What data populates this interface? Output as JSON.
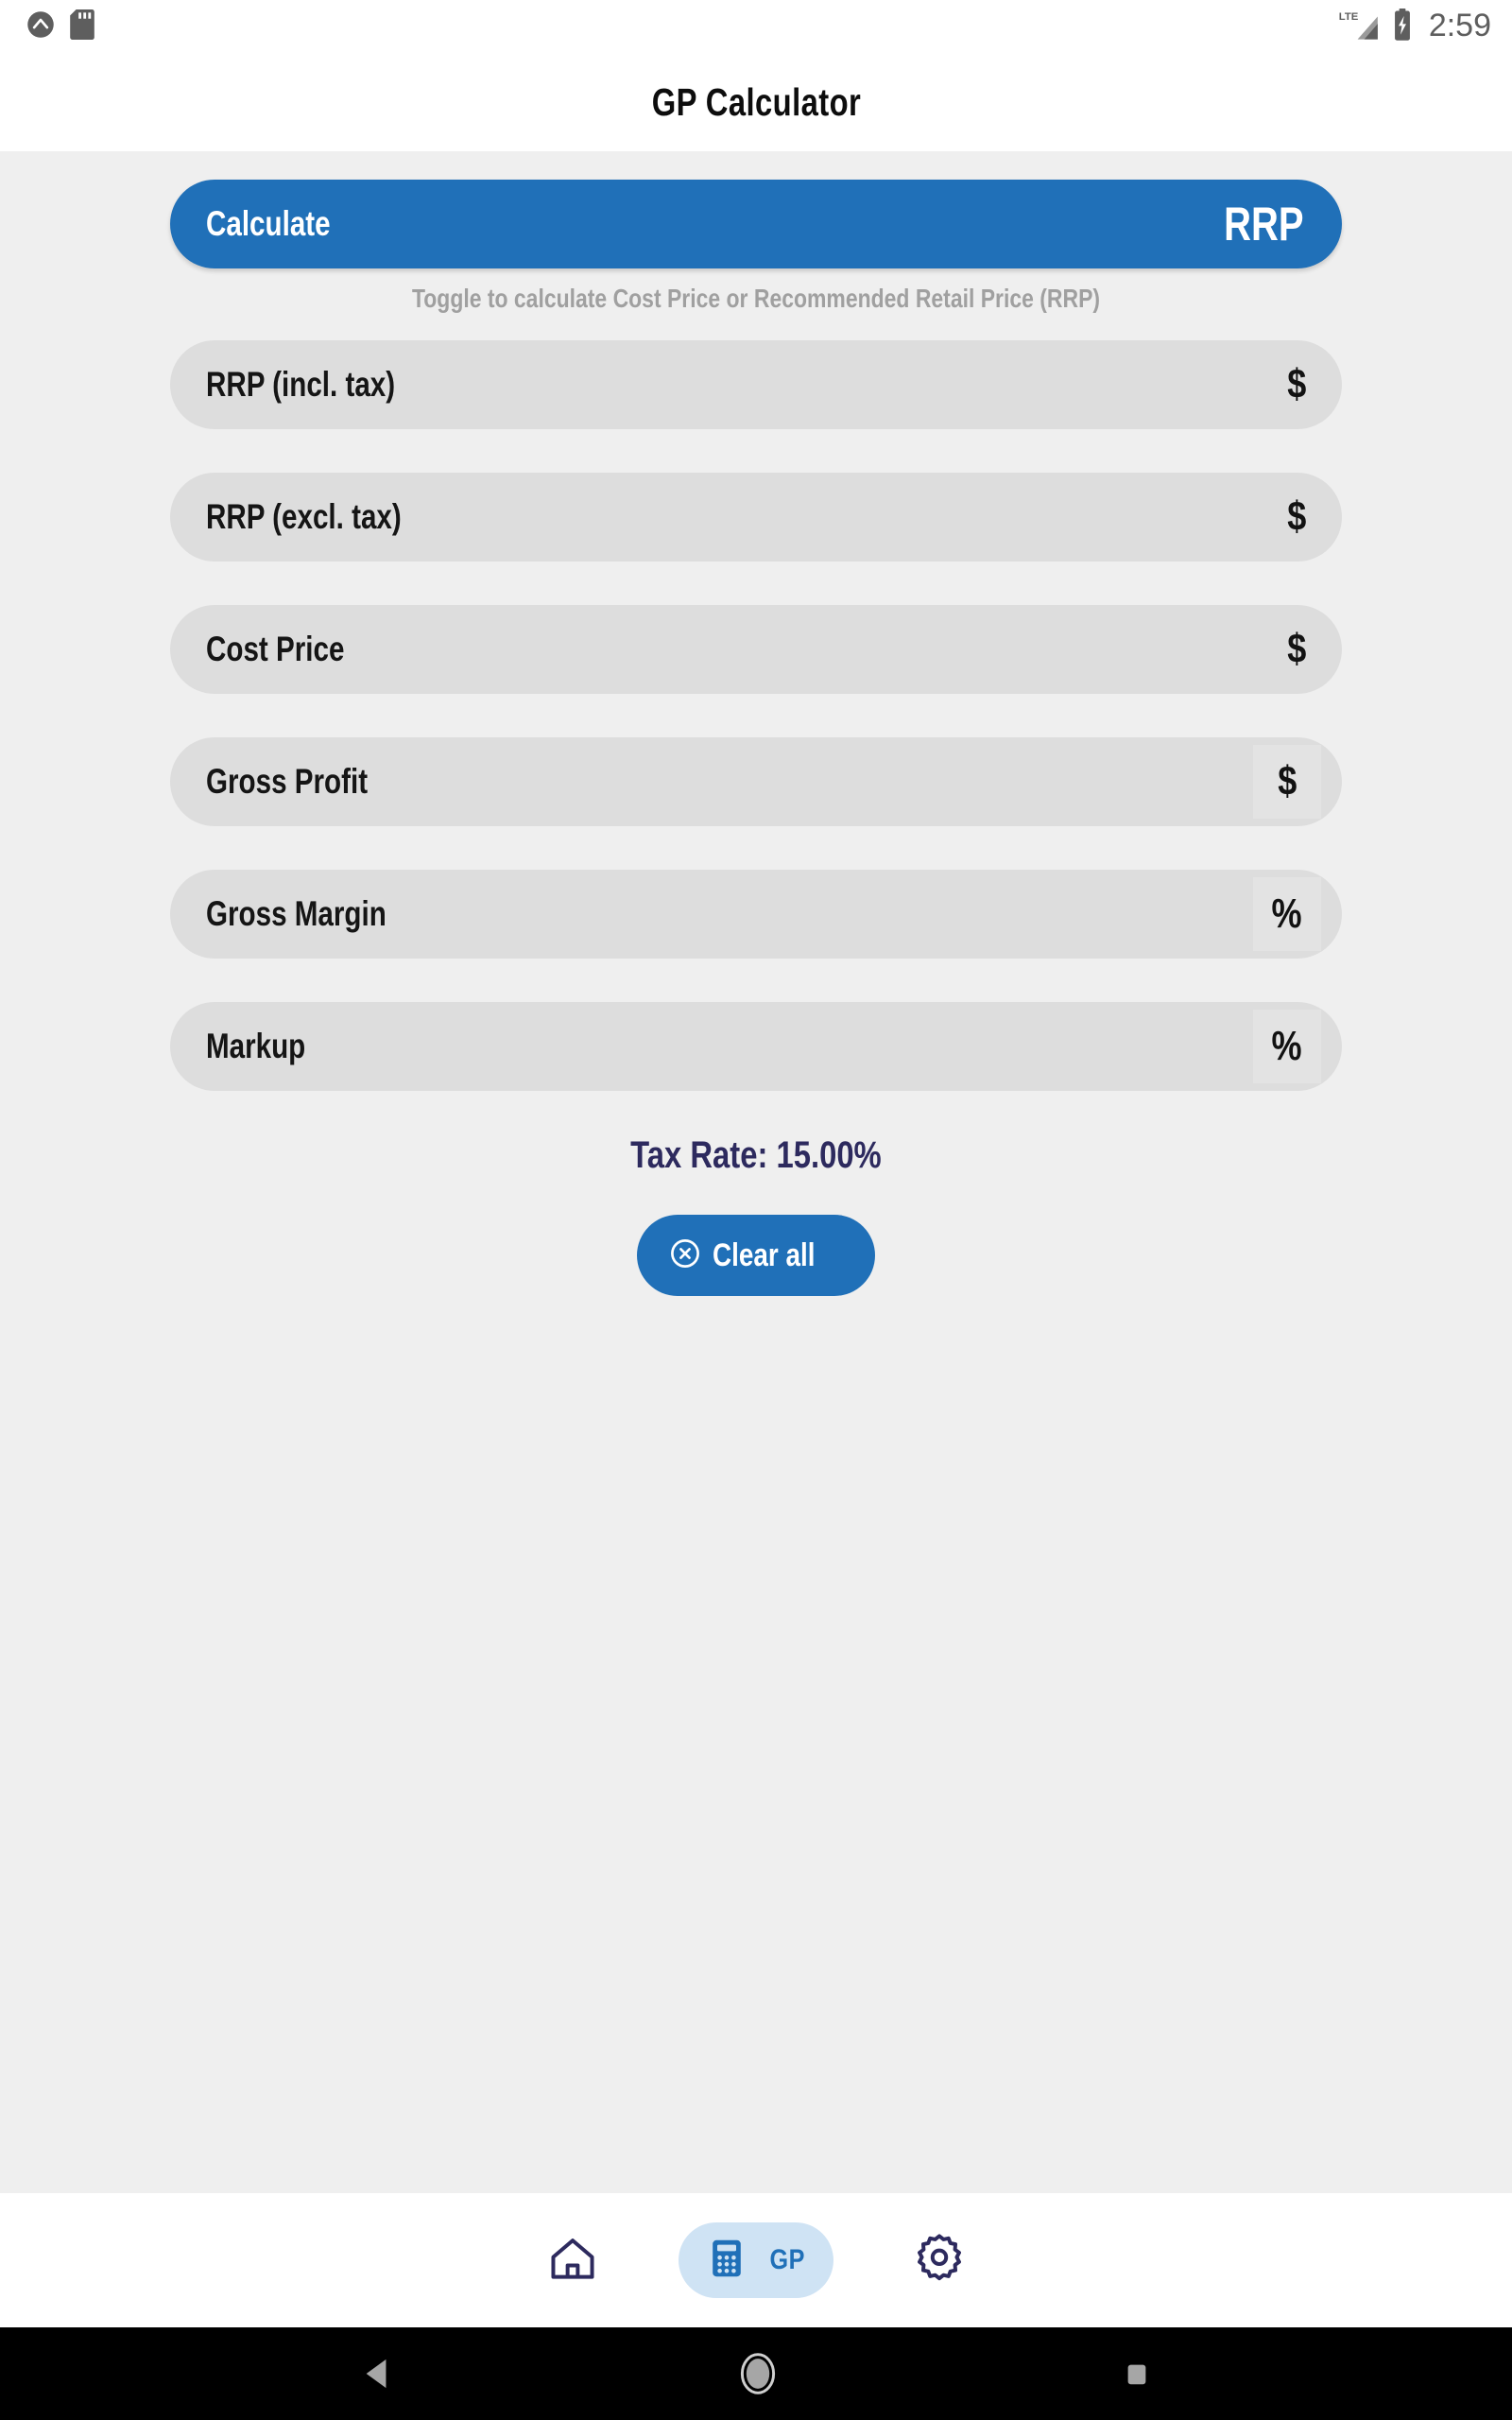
{
  "status_bar": {
    "left_icons": [
      {
        "name": "arrow-up-circle-icon",
        "label": "notification"
      },
      {
        "name": "sd-card-icon",
        "label": "sd-card"
      }
    ],
    "network": "LTE",
    "battery": "charging",
    "time": "2:59"
  },
  "app_bar": {
    "title": "GP Calculator"
  },
  "toggle": {
    "label": "Calculate",
    "value": "RRP",
    "hint": "Toggle to calculate Cost Price or Recommended Retail Price (RRP)",
    "options": [
      "RRP",
      "Cost Price"
    ]
  },
  "fields": [
    {
      "label": "RRP (incl. tax)",
      "value": "",
      "suffix": "$",
      "suffix_boxed": false,
      "readonly": false
    },
    {
      "label": "RRP (excl. tax)",
      "value": "",
      "suffix": "$",
      "suffix_boxed": false,
      "readonly": false
    },
    {
      "label": "Cost Price",
      "value": "",
      "suffix": "$",
      "suffix_boxed": false,
      "readonly": false
    },
    {
      "label": "Gross Profit",
      "value": "",
      "suffix": "$",
      "suffix_boxed": true,
      "readonly": true
    },
    {
      "label": "Gross Margin",
      "value": "",
      "suffix": "%",
      "suffix_boxed": true,
      "readonly": true
    },
    {
      "label": "Markup",
      "value": "",
      "suffix": "%",
      "suffix_boxed": true,
      "readonly": true
    }
  ],
  "tax_rate": {
    "label": "Tax Rate: ",
    "value": "15.00%",
    "color": "#2d2a5e"
  },
  "clear_button": {
    "label": "Clear all",
    "icon": "close-circle-icon"
  },
  "bottom_nav": {
    "items": [
      {
        "name": "home",
        "icon": "home-icon",
        "label": "",
        "active": false
      },
      {
        "name": "gp",
        "icon": "calculator-icon",
        "label": "GP",
        "active": true
      },
      {
        "name": "settings",
        "icon": "gear-icon",
        "label": "",
        "active": false
      }
    ]
  },
  "android_nav": {
    "back": "back-triangle-icon",
    "home": "home-circle-icon",
    "recents": "recents-square-icon"
  },
  "colors": {
    "accent": "#2070b8",
    "page_bg": "#efefef",
    "field_bg": "#dddddd",
    "field_suffix_bg": "#e3e3e3",
    "nav_active_bg": "#cfe3f4",
    "tax_text": "#2d2a5e"
  }
}
